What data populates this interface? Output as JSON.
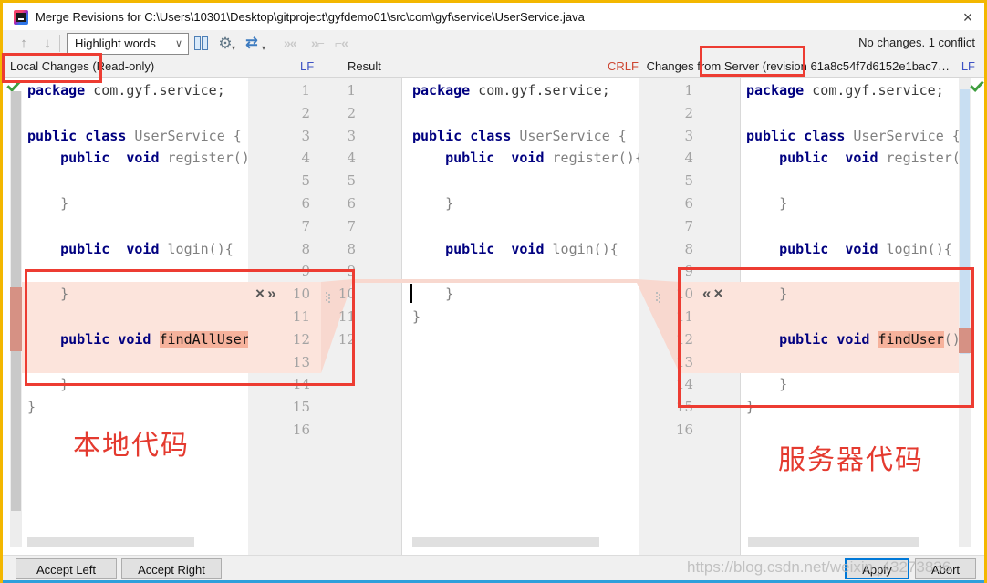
{
  "window": {
    "title": "Merge Revisions for C:\\Users\\10301\\Desktop\\gitproject\\gyfdemo01\\src\\com\\gyf\\service\\UserService.java",
    "close_glyph": "×"
  },
  "toolbar": {
    "highlight_mode": "Highlight words",
    "status": "No changes. 1 conflict",
    "glyphs": {
      "up": "↑",
      "down": "↓",
      "chevron": "∨",
      "gear": "⚙",
      "swap": "⇄",
      "caret": "▾",
      "apply_all": "»«",
      "apply_right": "»⌐",
      "apply_left": "⌐«"
    }
  },
  "headers": {
    "left_title": "Local Changes (Read-only)",
    "left_eol": "LF",
    "result_title": "Result",
    "result_eol": "CRLF",
    "right_title": "Changes from Server (revision 61a8c54f7d6152e1bac7…",
    "right_eol": "LF"
  },
  "gutter_actions": {
    "left": [
      "×",
      "»"
    ],
    "right": [
      "«",
      "×"
    ]
  },
  "editors": {
    "left": {
      "numbers": [
        "1",
        "2",
        "3",
        "4",
        "5",
        "6",
        "7",
        "8",
        "9",
        "10",
        "11",
        "12",
        "13",
        "14",
        "15",
        "16"
      ],
      "lines": [
        {
          "n": 1,
          "segs": [
            {
              "s": "kw",
              "t": "package"
            },
            {
              "s": "dark",
              "t": " com.gyf.service;"
            }
          ]
        },
        {
          "n": 3,
          "segs": [
            {
              "s": "kw",
              "t": "public class"
            },
            {
              "s": "id",
              "t": " UserService {"
            }
          ]
        },
        {
          "n": 4,
          "segs": [
            {
              "s": "id",
              "t": "    "
            },
            {
              "s": "kw",
              "t": "public  void"
            },
            {
              "s": "id",
              "t": " register(){"
            }
          ]
        },
        {
          "n": 6,
          "segs": [
            {
              "s": "id",
              "t": "    }"
            }
          ]
        },
        {
          "n": 8,
          "segs": [
            {
              "s": "id",
              "t": "    "
            },
            {
              "s": "kw",
              "t": "public  void"
            },
            {
              "s": "id",
              "t": " login(){"
            }
          ]
        },
        {
          "n": 10,
          "segs": [
            {
              "s": "id",
              "t": "    }"
            }
          ]
        },
        {
          "n": 12,
          "segs": [
            {
              "s": "id",
              "t": "    "
            },
            {
              "s": "kw",
              "t": "public void"
            },
            {
              "s": "id",
              "t": " "
            },
            {
              "s": "hl",
              "t": "findAllUsers"
            },
            {
              "s": "id",
              "t": "(){"
            }
          ]
        },
        {
          "n": 14,
          "segs": [
            {
              "s": "id",
              "t": "    }"
            }
          ]
        },
        {
          "n": 15,
          "segs": [
            {
              "s": "id",
              "t": "}"
            }
          ]
        }
      ]
    },
    "result": {
      "numbers": [
        "1",
        "2",
        "3",
        "4",
        "5",
        "6",
        "7",
        "8",
        "9",
        "10",
        "11",
        "12"
      ],
      "lines": [
        {
          "n": 1,
          "segs": [
            {
              "s": "kw",
              "t": "package"
            },
            {
              "s": "dark",
              "t": " com.gyf.service;"
            }
          ]
        },
        {
          "n": 3,
          "segs": [
            {
              "s": "kw",
              "t": "public class"
            },
            {
              "s": "id",
              "t": " UserService {"
            }
          ]
        },
        {
          "n": 4,
          "segs": [
            {
              "s": "id",
              "t": "    "
            },
            {
              "s": "kw",
              "t": "public  void"
            },
            {
              "s": "id",
              "t": " register(){"
            }
          ]
        },
        {
          "n": 6,
          "segs": [
            {
              "s": "id",
              "t": "    }"
            }
          ]
        },
        {
          "n": 8,
          "segs": [
            {
              "s": "id",
              "t": "    "
            },
            {
              "s": "kw",
              "t": "public  void"
            },
            {
              "s": "id",
              "t": " login(){"
            }
          ]
        },
        {
          "n": 10,
          "segs": [
            {
              "s": "id",
              "t": "    }"
            }
          ]
        },
        {
          "n": 11,
          "segs": [
            {
              "s": "id",
              "t": "}"
            }
          ]
        }
      ]
    },
    "right": {
      "numbers": [
        "1",
        "2",
        "3",
        "4",
        "5",
        "6",
        "7",
        "8",
        "9",
        "10",
        "11",
        "12",
        "13",
        "14",
        "15",
        "16"
      ],
      "lines": [
        {
          "n": 1,
          "segs": [
            {
              "s": "kw",
              "t": "package"
            },
            {
              "s": "dark",
              "t": " com.gyf.service;"
            }
          ]
        },
        {
          "n": 3,
          "segs": [
            {
              "s": "kw",
              "t": "public class"
            },
            {
              "s": "id",
              "t": " UserService {"
            }
          ]
        },
        {
          "n": 4,
          "segs": [
            {
              "s": "id",
              "t": "    "
            },
            {
              "s": "kw",
              "t": "public  void"
            },
            {
              "s": "id",
              "t": " register(){"
            }
          ]
        },
        {
          "n": 6,
          "segs": [
            {
              "s": "id",
              "t": "    }"
            }
          ]
        },
        {
          "n": 8,
          "segs": [
            {
              "s": "id",
              "t": "    "
            },
            {
              "s": "kw",
              "t": "public  void"
            },
            {
              "s": "id",
              "t": " login(){"
            }
          ]
        },
        {
          "n": 10,
          "segs": [
            {
              "s": "id",
              "t": "    }"
            }
          ]
        },
        {
          "n": 12,
          "segs": [
            {
              "s": "id",
              "t": "    "
            },
            {
              "s": "kw",
              "t": "public void"
            },
            {
              "s": "id",
              "t": " "
            },
            {
              "s": "hl",
              "t": "findUser"
            },
            {
              "s": "id",
              "t": "(){"
            }
          ]
        },
        {
          "n": 14,
          "segs": [
            {
              "s": "id",
              "t": "    }"
            }
          ]
        },
        {
          "n": 15,
          "segs": [
            {
              "s": "id",
              "t": "}"
            }
          ]
        }
      ]
    }
  },
  "annotations": {
    "local_code_label": "本地代码",
    "server_code_label": "服务器代码"
  },
  "watermark": {
    "text": "https://blog.csdn.net/weixin_43273836"
  },
  "buttons": {
    "accept_left": "Accept Left",
    "accept_right": "Accept Right",
    "apply": "Apply",
    "abort": "Abort"
  },
  "colors": {
    "accent_blue": "#0078d7",
    "conflict_pink": "#fce4dc",
    "conflict_word": "#f6b29c",
    "annotation_red": "#ed3c32",
    "keyword_navy": "#000080",
    "border_gold": "#f3b700"
  }
}
